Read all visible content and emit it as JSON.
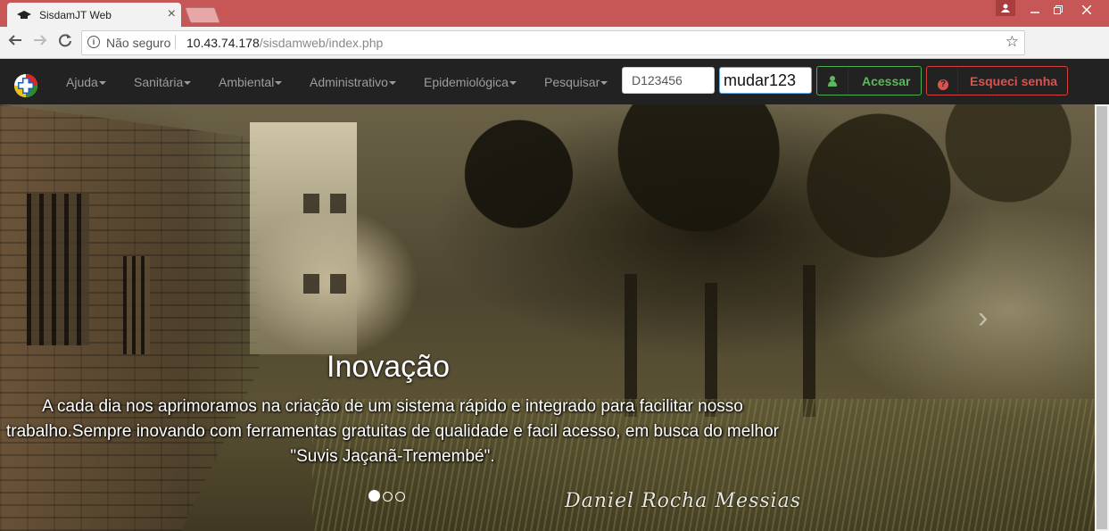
{
  "browser": {
    "tab_title": "SisdamJT Web",
    "tab_close": "×",
    "security_label": "Não seguro",
    "url_host": "10.43.74.178",
    "url_path": "/sisdamweb/index.php",
    "profile_ext": "T"
  },
  "navbar": {
    "menu": [
      {
        "label": "Ajuda"
      },
      {
        "label": "Sanitária"
      },
      {
        "label": "Ambiental"
      },
      {
        "label": "Administrativo"
      },
      {
        "label": "Epidemiológica"
      },
      {
        "label": "Pesquisar"
      }
    ],
    "login": {
      "user_value": "D123456",
      "password_value": "mudar123",
      "acessar_label": "Acessar",
      "esqueci_label": "Esqueci senha"
    }
  },
  "carousel": {
    "title": "Inovação",
    "text": "A cada dia nos aprimoramos na criação de um sistema rápido e integrado para facilitar nosso trabalho.Sempre inovando com ferramentas gratuitas de qualidade e facil acesso, em busca do melhor \"Suvis Jaçanã-Tremembé\".",
    "signature": "Daniel Rocha Messias",
    "active_slide": 1,
    "slide_count": 3
  },
  "colors": {
    "tabstrip": "#c75656",
    "navbar": "#222222",
    "success": "#5cb85c",
    "danger": "#d9534f"
  }
}
